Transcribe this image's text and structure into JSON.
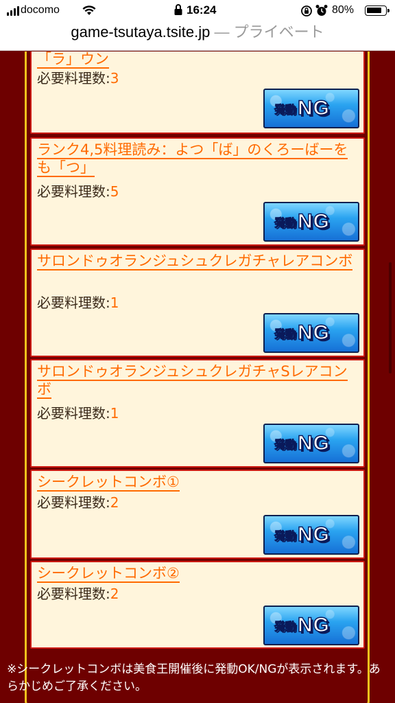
{
  "status_bar": {
    "carrier": "docomo",
    "time": "16:24",
    "battery": "80%",
    "icons": [
      "signal-icon",
      "wifi-icon",
      "lock-icon",
      "rotation-lock-icon",
      "alarm-icon",
      "battery-icon"
    ]
  },
  "url_bar": {
    "host": "game-tsutaya.tsite.jp",
    "mode": " — プライベート"
  },
  "colors": {
    "background": "#6e0000",
    "panel_border": "#f2c21c",
    "card_bg": "#fff5dc",
    "card_border": "#cc1a12",
    "link": "#ff6a00",
    "button_blue": "#1670d6"
  },
  "combos": [
    {
      "name": "「ラ」ウン",
      "req_label": "必要料理数:",
      "req_value": "3",
      "button_small": "発動",
      "button_big": "NG"
    },
    {
      "name": "ランク4,5料理読み：よつ「ば」のくろーばーをも「つ」",
      "req_label": "必要料理数:",
      "req_value": "5",
      "button_small": "発動",
      "button_big": "NG"
    },
    {
      "name": "サロンドゥオランジュシュクレガチャレアコンボ",
      "req_label": "必要料理数:",
      "req_value": "1",
      "button_small": "発動",
      "button_big": "NG"
    },
    {
      "name": "サロンドゥオランジュシュクレガチャSレアコンボ",
      "req_label": "必要料理数:",
      "req_value": "1",
      "button_small": "発動",
      "button_big": "NG"
    },
    {
      "name": "シークレットコンボ①",
      "req_label": "必要料理数:",
      "req_value": "2",
      "button_small": "発動",
      "button_big": "NG"
    },
    {
      "name": "シークレットコンボ②",
      "req_label": "必要料理数:",
      "req_value": "2",
      "button_small": "発動",
      "button_big": "NG"
    }
  ],
  "footnote": "※シークレットコンボは美食王開催後に発動OK/NGが表示されます。あらかじめご了承ください。"
}
